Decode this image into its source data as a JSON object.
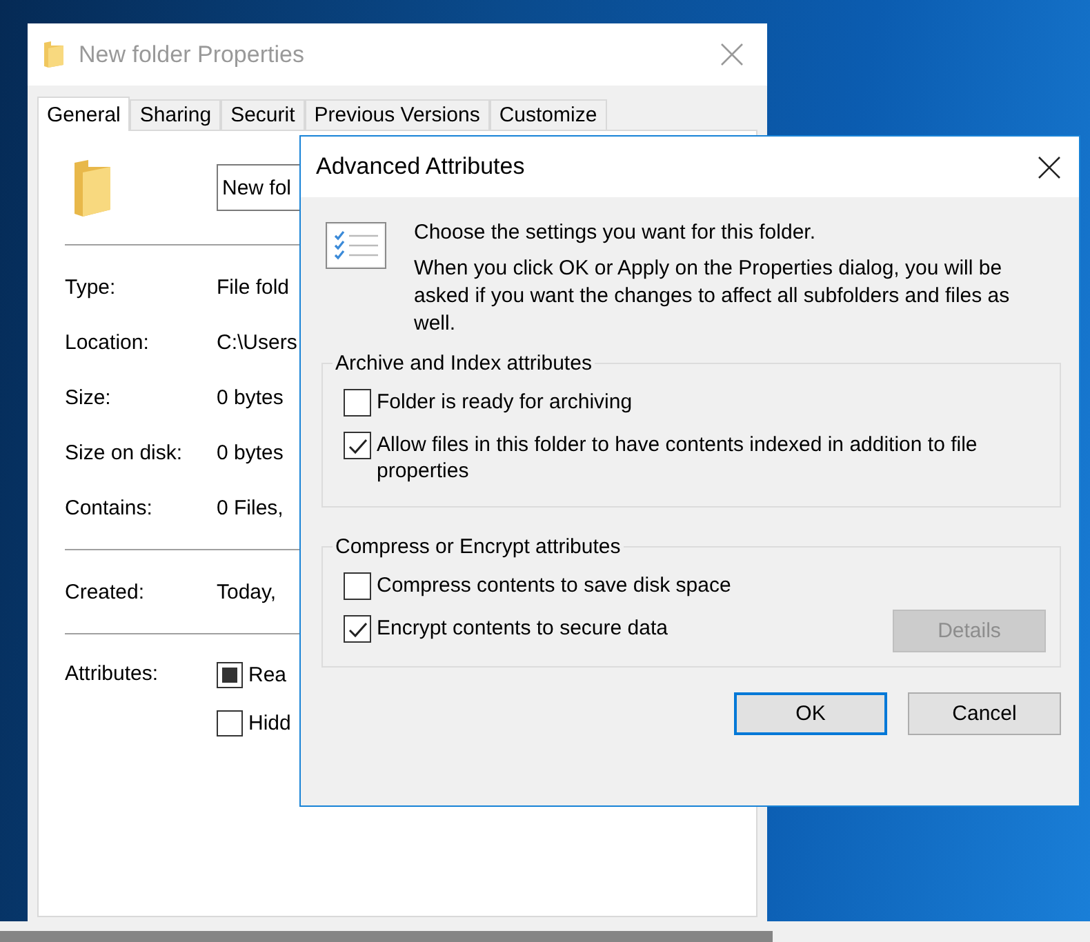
{
  "properties_window": {
    "title": "New folder Properties",
    "tabs": [
      {
        "label": "General",
        "selected": true
      },
      {
        "label": "Sharing",
        "selected": false
      },
      {
        "label": "Securit",
        "selected": false
      },
      {
        "label": "Previous Versions",
        "selected": false
      },
      {
        "label": "Customize",
        "selected": false
      }
    ],
    "name_field": {
      "value": "New fol"
    },
    "info_sections": [
      [
        {
          "label": "Type:",
          "value": "File fold"
        },
        {
          "label": "Location:",
          "value": "C:\\Users"
        },
        {
          "label": "Size:",
          "value": "0 bytes"
        },
        {
          "label": "Size on disk:",
          "value": "0 bytes"
        },
        {
          "label": "Contains:",
          "value": "0 Files,"
        }
      ],
      [
        {
          "label": "Created:",
          "value": "Today,"
        }
      ]
    ],
    "attributes": {
      "label": "Attributes:",
      "options": [
        {
          "label": "Rea",
          "indeterminate": true
        },
        {
          "label": "Hidd",
          "indeterminate": false
        }
      ]
    }
  },
  "dialog": {
    "title": "Advanced Attributes",
    "intro": "Choose the settings you want for this folder.",
    "note": "When you click OK or Apply on the Properties dialog, you will be asked if you want the changes to affect all subfolders and files as well.",
    "groups": [
      {
        "title": "Archive and Index attributes",
        "options": [
          {
            "label": "Folder is ready for archiving",
            "checked": false
          },
          {
            "label": "Allow files in this folder to have contents indexed in addition to file properties",
            "checked": true
          }
        ]
      },
      {
        "title": "Compress or Encrypt attributes",
        "options": [
          {
            "label": "Compress contents to save disk space",
            "checked": false
          },
          {
            "label": "Encrypt contents to secure data",
            "checked": true
          }
        ],
        "action": {
          "label": "Details",
          "disabled": true
        }
      }
    ],
    "buttons": [
      {
        "label": "OK",
        "default": true
      },
      {
        "label": "Cancel",
        "default": false
      }
    ]
  }
}
